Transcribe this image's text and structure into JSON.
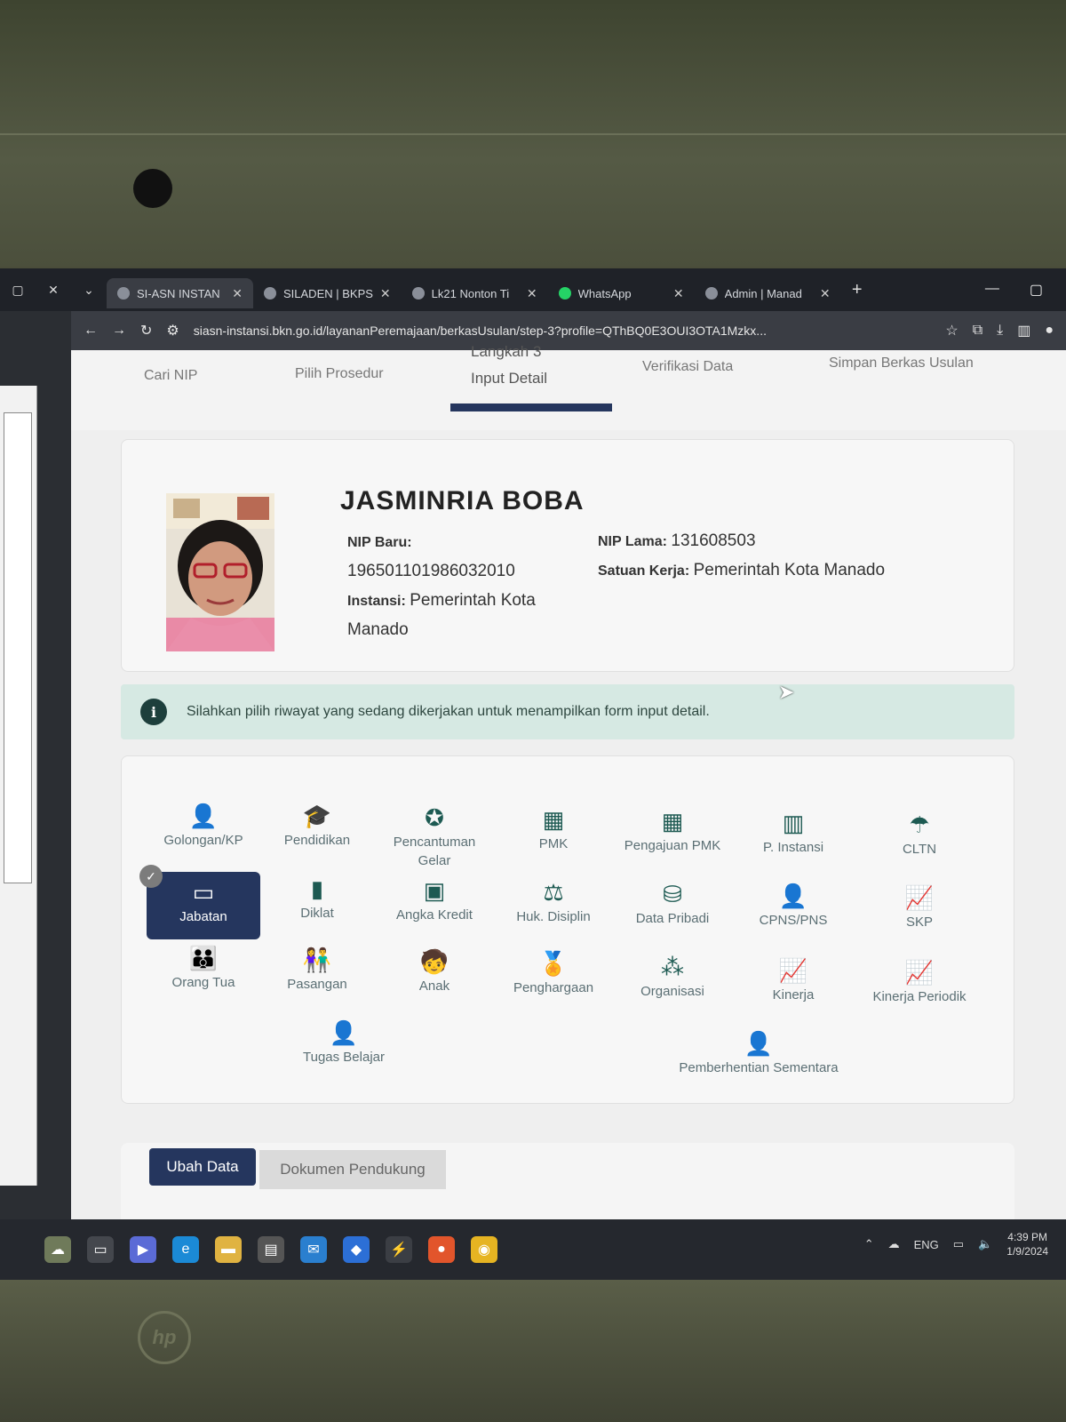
{
  "browser": {
    "tabs": [
      {
        "label": "SI-ASN INSTAN",
        "active": true,
        "icon": "site-icon"
      },
      {
        "label": "SILADEN | BKPS",
        "active": false,
        "icon": "site-icon"
      },
      {
        "label": "Lk21 Nonton Ti",
        "active": false,
        "icon": "site-icon"
      },
      {
        "label": "WhatsApp",
        "active": false,
        "icon": "whatsapp-icon"
      },
      {
        "label": "Admin | Manad",
        "active": false,
        "icon": "site-icon"
      }
    ],
    "url": "siasn-instansi.bkn.go.id/layananPeremajaan/berkasUsulan/step-3?profile=QThBQ0E3OUI3OTA1Mzkx..."
  },
  "stepper": {
    "steps": [
      {
        "label": "Cari NIP"
      },
      {
        "label": "Pilih Prosedur"
      },
      {
        "label": "Input Detail",
        "heading": "Langkah 3"
      },
      {
        "label": "Verifikasi Data"
      },
      {
        "label": "Simpan Berkas Usulan"
      }
    ],
    "active_index": 2
  },
  "profile": {
    "name": "JASMINRIA BOBA",
    "nip_baru_label": "NIP Baru:",
    "nip_baru": "196501101986032010",
    "instansi_label": "Instansi:",
    "instansi": "Pemerintah Kota Manado",
    "nip_lama_label": "NIP Lama:",
    "nip_lama": "131608503",
    "satuan_kerja_label": "Satuan Kerja:",
    "satuan_kerja": "Pemerintah Kota Manado"
  },
  "info": {
    "text": "Silahkan pilih riwayat yang sedang dikerjakan untuk menampilkan form input detail."
  },
  "menu": {
    "items": [
      {
        "label": "Golongan/KP",
        "icon": "user-up-icon"
      },
      {
        "label": "Pendidikan",
        "icon": "graduation-cap-icon"
      },
      {
        "label": "Pencantuman Gelar",
        "icon": "award-icon"
      },
      {
        "label": "PMK",
        "icon": "calendar-icon"
      },
      {
        "label": "Pengajuan PMK",
        "icon": "calendar-icon"
      },
      {
        "label": "P. Instansi",
        "icon": "building-icon"
      },
      {
        "label": "CLTN",
        "icon": "umbrella-beach-icon"
      },
      {
        "label": "Jabatan",
        "icon": "id-card-icon",
        "selected": true
      },
      {
        "label": "Diklat",
        "icon": "book-icon"
      },
      {
        "label": "Angka Kredit",
        "icon": "money-icon"
      },
      {
        "label": "Huk. Disiplin",
        "icon": "scale-icon"
      },
      {
        "label": "Data Pribadi",
        "icon": "database-icon"
      },
      {
        "label": "CPNS/PNS",
        "icon": "user-check-icon"
      },
      {
        "label": "SKP",
        "icon": "chart-line-icon"
      },
      {
        "label": "Orang Tua",
        "icon": "parents-icon"
      },
      {
        "label": "Pasangan",
        "icon": "couple-icon"
      },
      {
        "label": "Anak",
        "icon": "children-icon"
      },
      {
        "label": "Penghargaan",
        "icon": "medal-icon"
      },
      {
        "label": "Organisasi",
        "icon": "network-icon"
      },
      {
        "label": "Kinerja",
        "icon": "chart-line-icon"
      },
      {
        "label": "Kinerja Periodik",
        "icon": "chart-line-icon"
      },
      {
        "label": "Tugas Belajar",
        "icon": "user-check-icon"
      },
      {
        "label": "Pemberhentian Sementara",
        "icon": "user-check-icon"
      }
    ]
  },
  "actions": {
    "ubah_data": "Ubah Data",
    "dokumen_pendukung": "Dokumen Pendukung"
  },
  "taskbar": {
    "language": "ENG",
    "time": "4:39 PM",
    "date": "1/9/2024"
  },
  "colors": {
    "primary": "#25365e",
    "info_bg": "#d6e9e3",
    "icon": "#1d5a52"
  }
}
